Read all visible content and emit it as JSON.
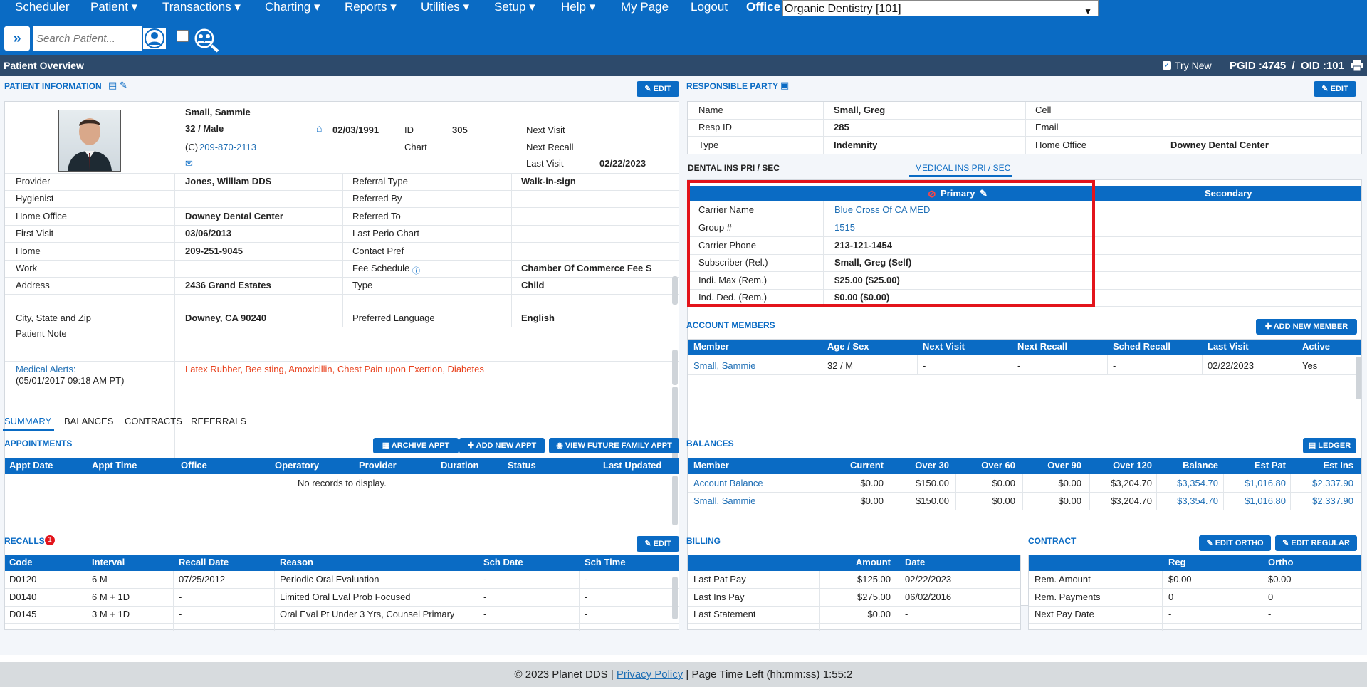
{
  "nav": {
    "items": [
      "Scheduler",
      "Patient ▾",
      "Transactions ▾",
      "Charting ▾",
      "Reports ▾",
      "Utilities ▾",
      "Setup ▾",
      "Help ▾",
      "My Page",
      "Logout"
    ],
    "office_label": "Office",
    "office_value": "Organic Dentistry [101]"
  },
  "toolbar": {
    "search_placeholder": "Search Patient..."
  },
  "titlebar": {
    "title": "Patient Overview",
    "try_new": "Try New",
    "ids": "PGID :4745  /  OID :101"
  },
  "patient": {
    "section": "PATIENT INFORMATION",
    "edit": "EDIT",
    "name": "Small, Sammie",
    "agesex": "32 / Male",
    "dob": "02/03/1991",
    "id_label": "ID",
    "id": "305",
    "chart_label": "Chart",
    "phone_prefix": "(C)",
    "phone": "209-870-2113",
    "next_visit_label": "Next Visit",
    "next_recall_label": "Next Recall",
    "last_visit_label": "Last Visit",
    "last_visit": "02/22/2023",
    "rows": [
      {
        "l1": "Provider",
        "v1": "Jones, William DDS",
        "l2": "Referral Type",
        "v2": "Walk-in-sign"
      },
      {
        "l1": "Hygienist",
        "v1": "",
        "l2": "Referred By",
        "v2": ""
      },
      {
        "l1": "Home Office",
        "v1": "Downey Dental Center",
        "l2": "Referred To",
        "v2": ""
      },
      {
        "l1": "First Visit",
        "v1": "03/06/2013",
        "l2": "Last Perio Chart",
        "v2": ""
      },
      {
        "l1": "Home",
        "v1": "209-251-9045",
        "l2": "Contact Pref",
        "v2": ""
      },
      {
        "l1": "Work",
        "v1": "",
        "l2": "Fee Schedule",
        "v2": "Chamber Of Commerce Fee S"
      },
      {
        "l1": "Address",
        "v1": "2436 Grand Estates",
        "l2": "Type",
        "v2": "Child"
      },
      {
        "l1": "City, State and Zip",
        "v1": "Downey, CA 90240",
        "l2": "Preferred Language",
        "v2": "English"
      }
    ],
    "note_label": "Patient Note",
    "alerts_label": "Medical Alerts:",
    "alerts_date": "(05/01/2017 09:18 AM PT)",
    "alerts": "Latex Rubber, Bee sting, Amoxicillin, Chest Pain upon Exertion, Diabetes"
  },
  "resp": {
    "section": "RESPONSIBLE PARTY",
    "edit": "EDIT",
    "rows": [
      {
        "l1": "Name",
        "v1": "Small, Greg",
        "l2": "Cell",
        "v2": ""
      },
      {
        "l1": "Resp ID",
        "v1": "285",
        "l2": "Email",
        "v2": ""
      },
      {
        "l1": "Type",
        "v1": "Indemnity",
        "l2": "Home Office",
        "v2": "Downey Dental Center"
      }
    ]
  },
  "ins": {
    "tab_dental": "DENTAL INS PRI / SEC",
    "tab_medical": "MEDICAL INS PRI / SEC",
    "primary": "Primary",
    "secondary": "Secondary",
    "rows": [
      {
        "l": "Carrier Name",
        "v": "Blue Cross Of CA MED"
      },
      {
        "l": "Group #",
        "v": "1515"
      },
      {
        "l": "Carrier Phone",
        "v": "213-121-1454"
      },
      {
        "l": "Subscriber (Rel.)",
        "v": "Small, Greg (Self)"
      },
      {
        "l": "Indi. Max (Rem.)",
        "v": "$25.00 ($25.00)"
      },
      {
        "l": "Ind. Ded. (Rem.)",
        "v": "$0.00 ($0.00)"
      }
    ]
  },
  "members": {
    "section": "ACCOUNT MEMBERS",
    "add": "ADD NEW MEMBER",
    "headers": [
      "Member",
      "Age / Sex",
      "Next Visit",
      "Next Recall",
      "Sched Recall",
      "Last Visit",
      "Active"
    ],
    "row": [
      "Small, Sammie",
      "32 / M",
      "-",
      "-",
      "-",
      "02/22/2023",
      "Yes"
    ]
  },
  "tabs": [
    "SUMMARY",
    "BALANCES",
    "CONTRACTS",
    "REFERRALS"
  ],
  "appts": {
    "section": "APPOINTMENTS",
    "archive": "ARCHIVE APPT",
    "add": "ADD NEW APPT",
    "future": "VIEW FUTURE FAMILY APPT",
    "headers": [
      "Appt Date",
      "Appt Time",
      "Office",
      "Operatory",
      "Provider",
      "Duration",
      "Status",
      "Last Updated"
    ],
    "empty": "No records to display."
  },
  "balances": {
    "section": "BALANCES",
    "ledger": "LEDGER",
    "headers": [
      "Member",
      "Current",
      "Over 30",
      "Over 60",
      "Over 90",
      "Over 120",
      "Balance",
      "Est Pat",
      "Est Ins"
    ],
    "rows": [
      [
        "Account Balance",
        "$0.00",
        "$150.00",
        "$0.00",
        "$0.00",
        "$3,204.70",
        "$3,354.70",
        "$1,016.80",
        "$2,337.90"
      ],
      [
        "Small, Sammie",
        "$0.00",
        "$150.00",
        "$0.00",
        "$0.00",
        "$3,204.70",
        "$3,354.70",
        "$1,016.80",
        "$2,337.90"
      ]
    ]
  },
  "recalls": {
    "section": "RECALLS",
    "badge": "1",
    "edit": "EDIT",
    "headers": [
      "Code",
      "Interval",
      "Recall Date",
      "Reason",
      "Sch Date",
      "Sch Time"
    ],
    "rows": [
      [
        "D0120",
        "6 M",
        "07/25/2012",
        "Periodic Oral Evaluation",
        "-",
        "-"
      ],
      [
        "D0140",
        "6 M + 1D",
        "-",
        "Limited Oral Eval Prob Focused",
        "-",
        "-"
      ],
      [
        "D0145",
        "3 M + 1D",
        "-",
        "Oral Eval Pt Under 3 Yrs, Counsel Primary",
        "-",
        "-"
      ]
    ]
  },
  "billing": {
    "section": "BILLING",
    "headers": [
      "",
      "Amount",
      "Date"
    ],
    "rows": [
      [
        "Last Pat Pay",
        "$125.00",
        "02/22/2023"
      ],
      [
        "Last Ins Pay",
        "$275.00",
        "06/02/2016"
      ],
      [
        "Last Statement",
        "$0.00",
        "-"
      ]
    ]
  },
  "contract": {
    "section": "CONTRACT",
    "edit_ortho": "EDIT ORTHO",
    "edit_regular": "EDIT REGULAR",
    "headers": [
      "",
      "Reg",
      "Ortho"
    ],
    "rows": [
      [
        "Rem. Amount",
        "$0.00",
        "$0.00"
      ],
      [
        "Rem. Payments",
        "0",
        "0"
      ],
      [
        "Next Pay Date",
        "-",
        "-"
      ]
    ]
  },
  "footer": {
    "copyright": "© 2023 Planet DDS | ",
    "privacy": "Privacy Policy",
    "rest": " |  Page Time Left (hh:mm:ss) 1:55:2"
  }
}
